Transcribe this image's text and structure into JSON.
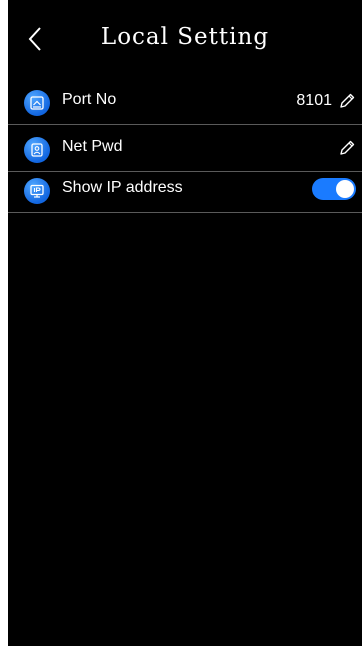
{
  "header": {
    "title": "Local Setting",
    "back_icon": "chevron-left-icon"
  },
  "settings": [
    {
      "label": "Port No",
      "value": "8101",
      "icon": "network-port-icon",
      "action_icon": "pencil-icon"
    },
    {
      "label": "Net Pwd",
      "value": "",
      "icon": "id-card-icon",
      "action_icon": "pencil-icon"
    },
    {
      "label": "Show IP address",
      "icon": "ip-display-icon",
      "toggle_on": true
    }
  ],
  "colors": {
    "background": "#000000",
    "accent": "#1a7bff",
    "divider": "#5a5a5a"
  }
}
